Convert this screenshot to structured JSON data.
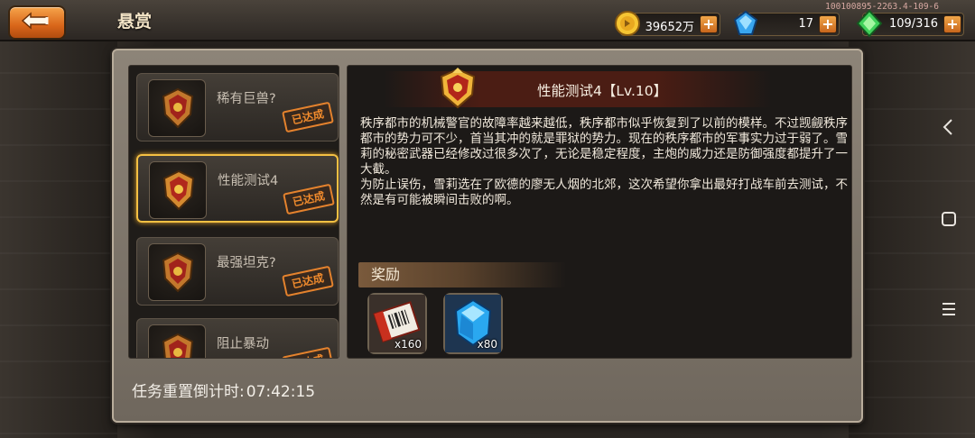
{
  "header": {
    "title": "悬赏",
    "build_info": "100100895-2263.4-109-6"
  },
  "resources": {
    "gold": {
      "icon": "gold-coin-icon",
      "value": "39652万"
    },
    "diamond": {
      "icon": "blue-diamond-icon",
      "value": "17"
    },
    "energy": {
      "icon": "green-gem-icon",
      "value": "109/316"
    },
    "plus_label": "+"
  },
  "quests": [
    {
      "name": "稀有巨兽?",
      "status": "已达成",
      "selected": false
    },
    {
      "name": "性能测试4",
      "status": "已达成",
      "selected": true
    },
    {
      "name": "最强坦克?",
      "status": "已达成",
      "selected": false
    },
    {
      "name": "阻止暴动",
      "status": "已达成",
      "selected": false
    }
  ],
  "detail": {
    "title": "性能测试4【Lv.10】",
    "description": "秩序都市的机械警官的故障率越来越低，秩序都市似乎恢复到了以前的模样。不过觊觎秩序都市的势力可不少，首当其冲的就是罪狱的势力。现在的秩序都市的军事实力过于弱了。雪莉的秘密武器已经修改过很多次了，无论是稳定程度，主炮的威力还是防御强度都提升了一大截。\n为防止误伤，雪莉选在了欧德的廖无人烟的北郊，这次希望你拿出最好打战车前去测试，不然是有可能被瞬间击败的啊。",
    "reward_label": "奖励",
    "rewards": [
      {
        "icon": "ticket-icon",
        "qty": "x160"
      },
      {
        "icon": "blue-crystal-icon",
        "qty": "x80"
      }
    ]
  },
  "footer": {
    "countdown_label": "任务重置倒计时:",
    "countdown_time": "07:42:15"
  },
  "colors": {
    "accent_orange": "#e4822d",
    "selected_gold": "#f4c043"
  }
}
